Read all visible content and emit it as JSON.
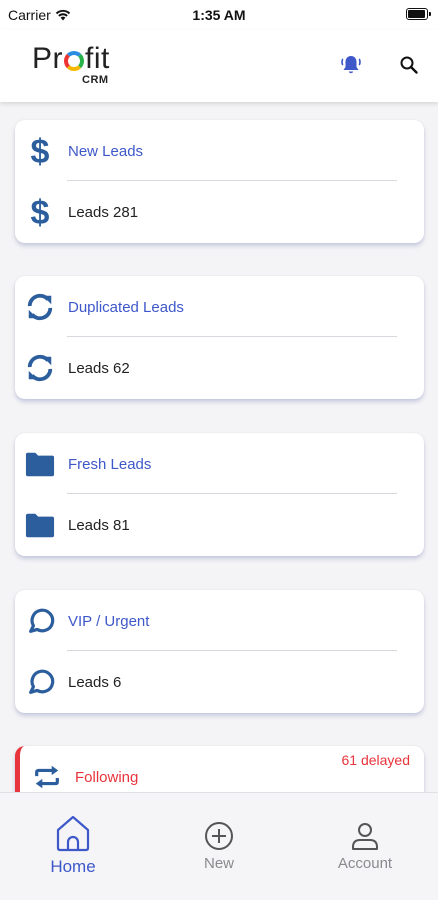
{
  "status_bar": {
    "carrier": "Carrier",
    "time": "1:35 AM",
    "battery_level": 1.0
  },
  "header": {
    "logo_left": "Pr",
    "logo_right": "fit",
    "logo_sub": "CRM",
    "icons": [
      "bell-icon",
      "search-icon"
    ]
  },
  "colors": {
    "accent": "#3e58c9",
    "icon_blue": "#2c5e9e",
    "alert_red": "#e8343c"
  },
  "cards": [
    {
      "title": "New Leads",
      "count": "Leads 281",
      "icon": "dollar-icon"
    },
    {
      "title": "Duplicated Leads",
      "count": "Leads 62",
      "icon": "sync-icon"
    },
    {
      "title": "Fresh Leads",
      "count": "Leads 81",
      "icon": "folder-icon"
    },
    {
      "title": "VIP / Urgent",
      "count": "Leads 6",
      "icon": "chat-bubble-icon"
    }
  ],
  "following": {
    "title": "Following",
    "delayed": "61 delayed",
    "icon": "repeat-icon"
  },
  "tabs": [
    {
      "label": "Home",
      "icon": "home-icon",
      "active": true
    },
    {
      "label": "New",
      "icon": "plus-circle-icon",
      "active": false
    },
    {
      "label": "Account",
      "icon": "user-icon",
      "active": false
    }
  ]
}
